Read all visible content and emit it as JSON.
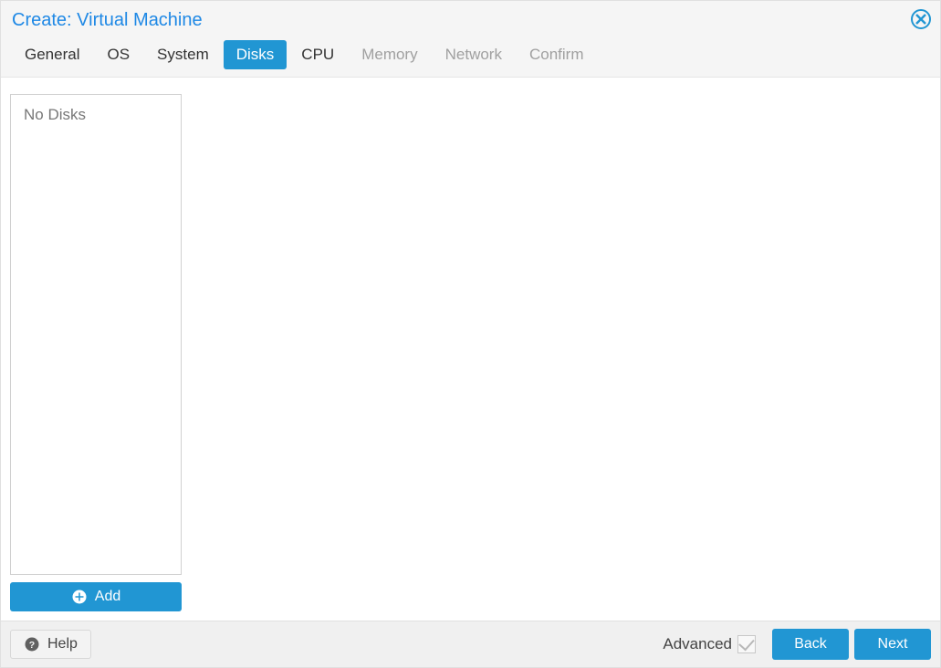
{
  "dialog": {
    "title": "Create: Virtual Machine"
  },
  "tabs": [
    {
      "label": "General",
      "state": "enabled"
    },
    {
      "label": "OS",
      "state": "enabled"
    },
    {
      "label": "System",
      "state": "enabled"
    },
    {
      "label": "Disks",
      "state": "active"
    },
    {
      "label": "CPU",
      "state": "enabled"
    },
    {
      "label": "Memory",
      "state": "disabled"
    },
    {
      "label": "Network",
      "state": "disabled"
    },
    {
      "label": "Confirm",
      "state": "disabled"
    }
  ],
  "disks": {
    "empty_text": "No Disks",
    "add_label": "Add"
  },
  "footer": {
    "help_label": "Help",
    "advanced_label": "Advanced",
    "advanced_checked": true,
    "back_label": "Back",
    "next_label": "Next"
  }
}
